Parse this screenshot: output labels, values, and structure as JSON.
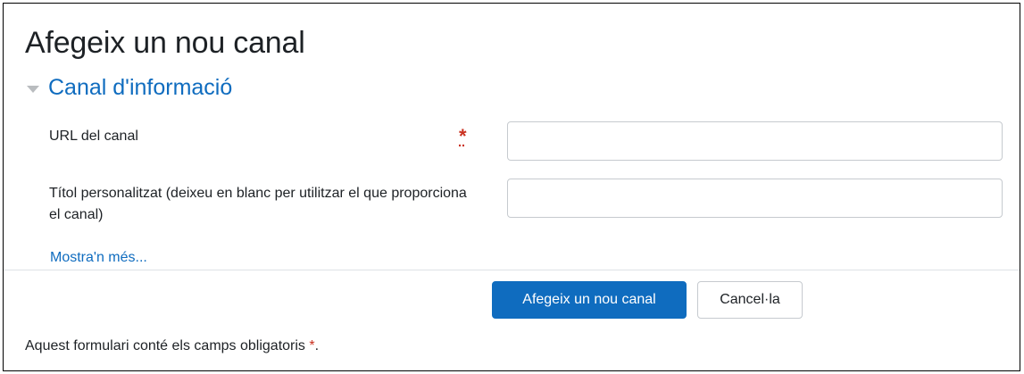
{
  "page": {
    "title": "Afegeix un nou canal"
  },
  "section": {
    "title": "Canal d'informació"
  },
  "fields": {
    "url": {
      "label": "URL del canal",
      "required_marker": "*",
      "value": ""
    },
    "custom_title": {
      "label": "Títol personalitzat (deixeu en blanc per utilitzar el que proporciona el canal)",
      "value": ""
    }
  },
  "show_more": "Mostra'n més...",
  "buttons": {
    "submit": "Afegeix un nou canal",
    "cancel": "Cancel·la"
  },
  "footnote": {
    "text": "Aquest formulari conté els camps obligatoris ",
    "star": "*",
    "period": "."
  },
  "colors": {
    "primary": "#0f6cbf",
    "required": "#ca3120"
  }
}
